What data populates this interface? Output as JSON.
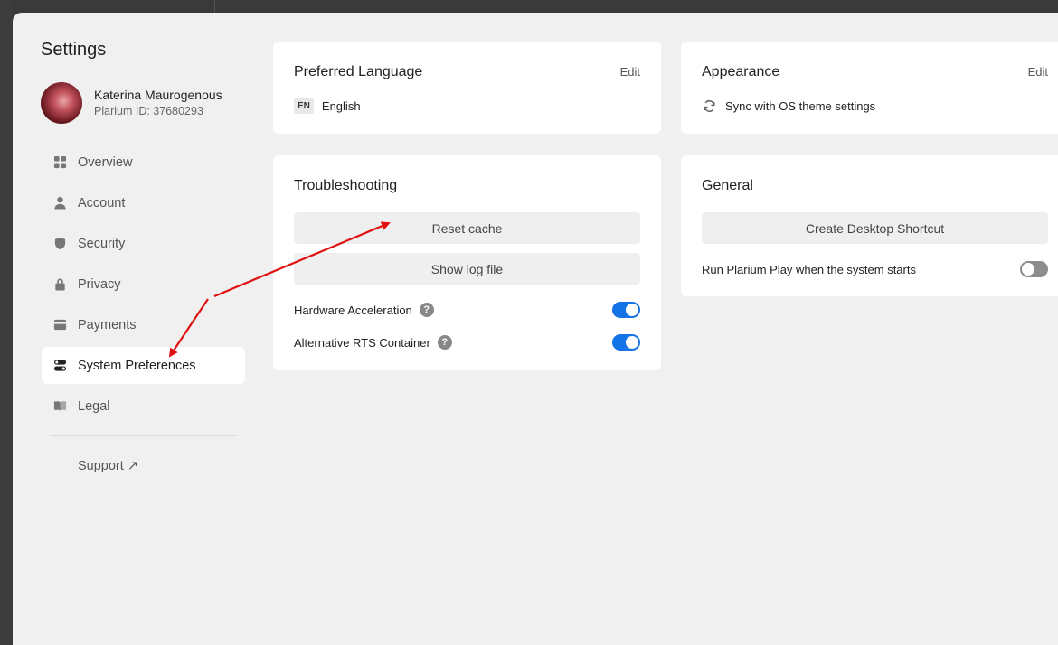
{
  "sidebar": {
    "title": "Settings",
    "user_name": "Katerina Maurogenous",
    "user_id": "Plarium ID: 37680293",
    "items": [
      {
        "label": "Overview",
        "icon": "grid-icon"
      },
      {
        "label": "Account",
        "icon": "user-icon"
      },
      {
        "label": "Security",
        "icon": "shield-icon"
      },
      {
        "label": "Privacy",
        "icon": "lock-icon"
      },
      {
        "label": "Payments",
        "icon": "card-icon"
      },
      {
        "label": "System Preferences",
        "icon": "toggles-icon",
        "active": true
      },
      {
        "label": "Legal",
        "icon": "book-icon"
      }
    ],
    "support": "Support ↗"
  },
  "language": {
    "title": "Preferred Language",
    "edit": "Edit",
    "badge": "EN",
    "value": "English"
  },
  "appearance": {
    "title": "Appearance",
    "edit": "Edit",
    "value": "Sync with OS theme settings"
  },
  "troubleshooting": {
    "title": "Troubleshooting",
    "reset_cache": "Reset cache",
    "show_log": "Show log file",
    "hw_accel": "Hardware Acceleration",
    "hw_accel_on": true,
    "rts": "Alternative RTS Container",
    "rts_on": true,
    "help": "?"
  },
  "general": {
    "title": "General",
    "shortcut": "Create Desktop Shortcut",
    "autostart": "Run Plarium Play when the system starts",
    "autostart_on": false
  },
  "colors": {
    "accent": "#1473e6",
    "annotation": "#e01010"
  }
}
